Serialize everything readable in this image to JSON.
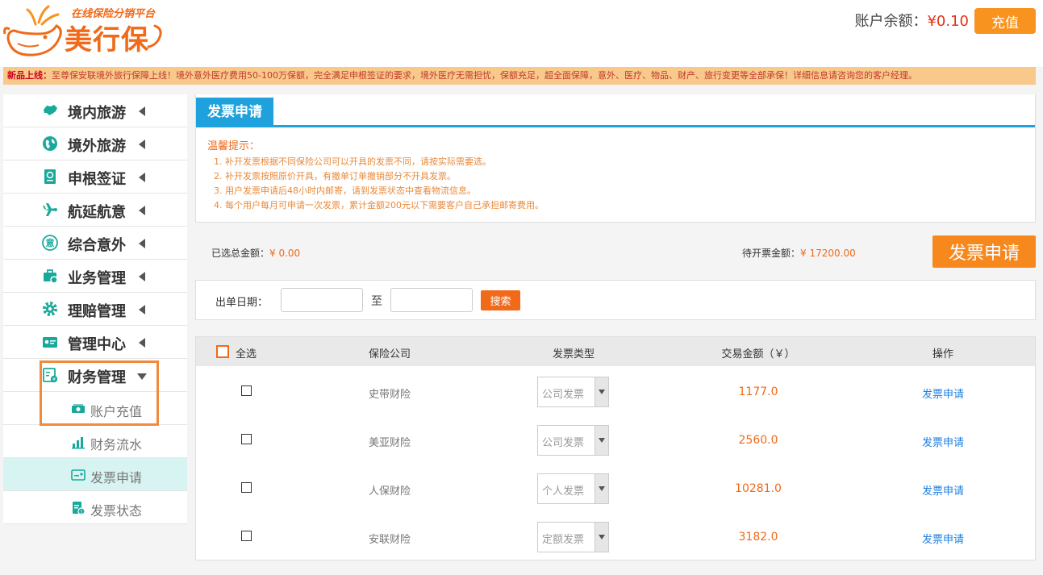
{
  "header": {
    "logo_slogan": "在线保险分销平台",
    "logo_name": "美行保",
    "balance_label": "账户余额：",
    "balance_value": "¥0.10",
    "recharge_label": "充值"
  },
  "notice": {
    "tag": "新品上线：",
    "text": "至尊保安联境外旅行保障上线！境外意外医疗费用50-100万保额，完全满足申根签证的要求，境外医疗无需担忧，保额充足，超全面保障，意外、医疗、物品、财产、旅行变更等全部承保！详细信息请咨询您的客户经理。"
  },
  "sidebar": {
    "items": [
      {
        "label": "境内旅游",
        "icon": "china-map-icon"
      },
      {
        "label": "境外旅游",
        "icon": "globe-icon"
      },
      {
        "label": "申根签证",
        "icon": "passport-icon"
      },
      {
        "label": "航延航意",
        "icon": "airplane-icon"
      },
      {
        "label": "综合意外",
        "icon": "accident-icon"
      },
      {
        "label": "业务管理",
        "icon": "briefcase-icon"
      },
      {
        "label": "理赔管理",
        "icon": "gear-icon"
      },
      {
        "label": "管理中心",
        "icon": "id-card-icon"
      },
      {
        "label": "财务管理",
        "icon": "finance-icon"
      }
    ],
    "subitems": [
      {
        "label": "账户充值",
        "icon": "money-icon"
      },
      {
        "label": "财务流水",
        "icon": "bar-chart-icon"
      },
      {
        "label": "发票申请",
        "icon": "invoice-card-icon"
      },
      {
        "label": "发票状态",
        "icon": "invoice-status-icon"
      }
    ]
  },
  "main": {
    "title": "发票申请",
    "tips_title": "温馨提示：",
    "tips": [
      "1. 补开发票根据不同保险公司可以开具的发票不同，请按实际需要选。",
      "2. 补开发票按照原价开具，有撤单订单撤销部分不开具发票。",
      "3. 用户发票申请后48小时内邮寄，请到发票状态中查看物流信息。",
      "4. 每个用户每月可申请一次发票，累计金额200元以下需要客户自己承担邮寄费用。"
    ],
    "selected_total_label": "已选总金额：",
    "selected_total_value": "¥ 0.00",
    "pending_label": "待开票金额：",
    "pending_value": "¥ 17200.00",
    "apply_button": "发票申请",
    "filter": {
      "date_label": "出单日期：",
      "to_label": "至",
      "start_value": "",
      "end_value": "",
      "search_button": "搜索"
    },
    "table": {
      "headers": {
        "select_all": "全选",
        "company": "保险公司",
        "invoice_type": "发票类型",
        "amount": "交易金额（￥）",
        "action": "操作"
      },
      "rows": [
        {
          "company": "史带财险",
          "invoice_type": "公司发票",
          "amount": "1177.0",
          "action": "发票申请"
        },
        {
          "company": "美亚财险",
          "invoice_type": "公司发票",
          "amount": "2560.0",
          "action": "发票申请"
        },
        {
          "company": "人保财险",
          "invoice_type": "个人发票",
          "amount": "10281.0",
          "action": "发票申请"
        },
        {
          "company": "安联财险",
          "invoice_type": "定额发票",
          "amount": "3182.0",
          "action": "发票申请"
        }
      ]
    }
  },
  "colors": {
    "brand_orange": "#f06a1a",
    "button_orange": "#f7931e",
    "title_blue": "#1ea1dc",
    "link_blue": "#1f7fe0",
    "icon_teal": "#19a99b"
  }
}
